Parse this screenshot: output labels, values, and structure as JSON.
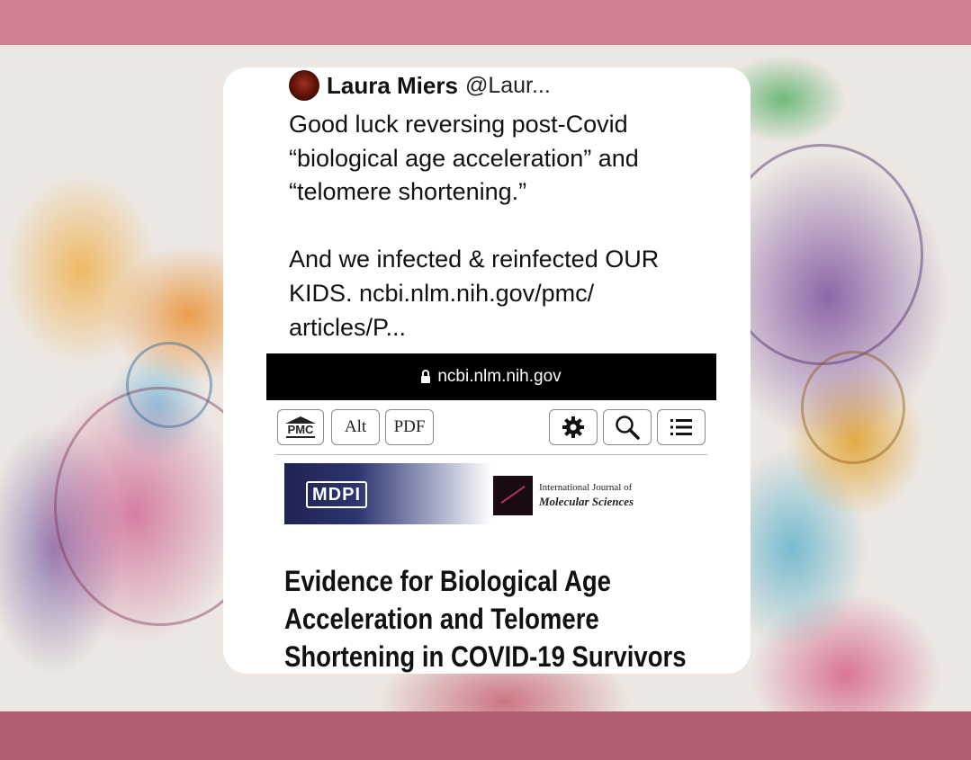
{
  "tweet": {
    "author_name": "Laura Miers",
    "author_handle": "@Laur...",
    "text": "Good luck reversing post-Covid\n“biological age acceleration” and\n“telomere shortening.”\n\nAnd we infected & reinfected OUR\nKIDS. ncbi.nlm.nih.gov/pmc/\narticles/P..."
  },
  "embedded_screenshot": {
    "url": "ncbi.nlm.nih.gov",
    "toolbar": {
      "pmc_label": "PMC",
      "alt_label": "Alt",
      "pdf_label": "PDF",
      "icons": [
        "gear-icon",
        "search-icon",
        "list-icon"
      ]
    },
    "publisher": {
      "mdpi_label": "MDPI",
      "journal_line1": "International Journal of",
      "journal_line2": "Molecular Sciences"
    },
    "article_title": "Evidence for Biological Age\nAcceleration and Telomere\nShortening in COVID-19 Survivors"
  },
  "colors": {
    "top_band": "#cf7f90",
    "bottom_band": "#b05e6f",
    "card": "#ffffff",
    "url_bar": "#000000"
  }
}
